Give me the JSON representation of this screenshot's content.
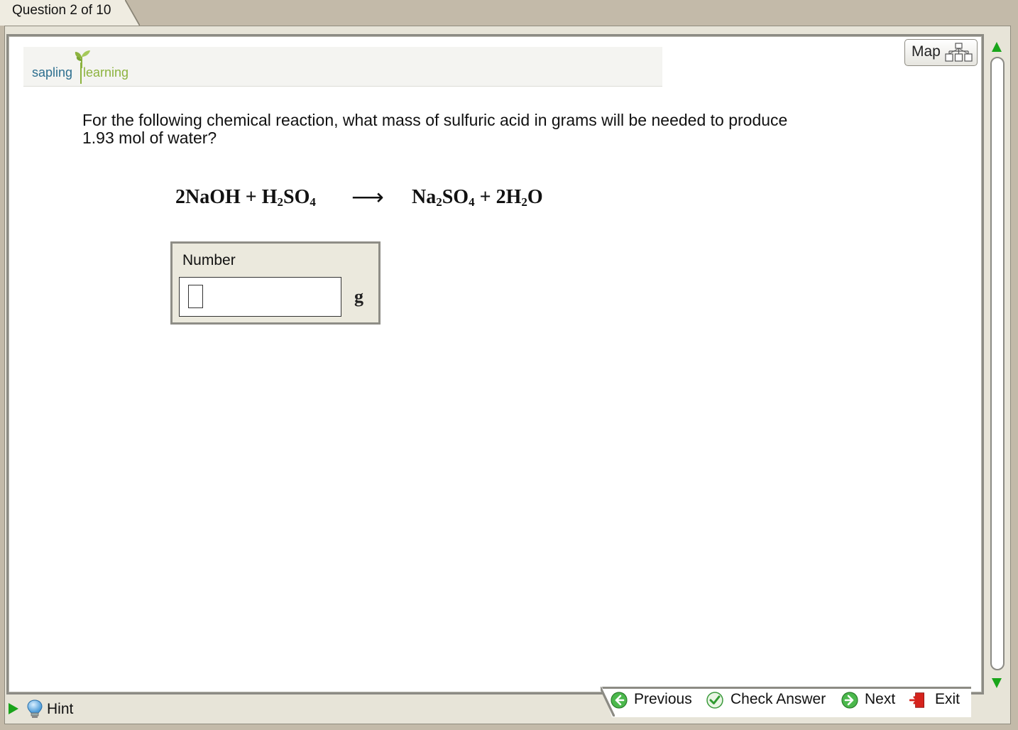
{
  "header": {
    "question_counter": "Question 2 of 10"
  },
  "logo": {
    "primary": "sapling",
    "secondary": "learning"
  },
  "map": {
    "label": "Map"
  },
  "question": {
    "text": "For the following chemical reaction, what mass of sulfuric acid in grams will be needed to produce 1.93 mol of water?"
  },
  "equation": {
    "reactant1_coef": "2",
    "reactant1": "NaOH",
    "plus1": " + ",
    "reactant2_a": "H",
    "reactant2_sub1": "2",
    "reactant2_b": "SO",
    "reactant2_sub2": "4",
    "arrow": "⟶",
    "product1_a": "Na",
    "product1_sub1": "2",
    "product1_b": "SO",
    "product1_sub2": "4",
    "plus2": " + ",
    "product2_coef": "2",
    "product2_a": "H",
    "product2_sub": "2",
    "product2_b": "O"
  },
  "answer": {
    "label": "Number",
    "value": "",
    "unit": "g"
  },
  "footer": {
    "hint": "Hint",
    "previous": "Previous",
    "check_answer": "Check Answer",
    "next": "Next",
    "exit": "Exit"
  },
  "colors": {
    "accent_green": "#19a51a",
    "brand_blue": "#2d6f8f",
    "brand_green": "#8db33f",
    "exit_red": "#d6231d"
  }
}
